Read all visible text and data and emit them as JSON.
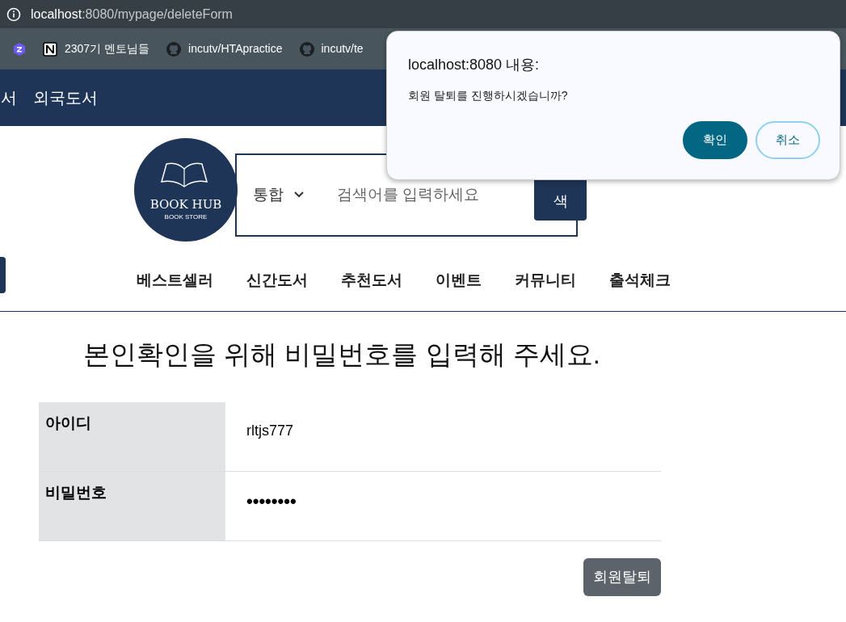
{
  "browser": {
    "url_host": "localhost",
    "url_path": ":8080/mypage/deleteForm",
    "bookmarks": [
      {
        "kind": "app"
      },
      {
        "kind": "notion",
        "label": "2307기 멘토님들"
      },
      {
        "kind": "github",
        "label": "incutv/HTApractice"
      },
      {
        "kind": "github",
        "label": "incutv/te"
      }
    ]
  },
  "top_nav": [
    "서",
    "외국도서"
  ],
  "search": {
    "category": "통합",
    "placeholder": "검색어를 입력하세요",
    "button": "색"
  },
  "logo": {
    "title": "BOOK HUB",
    "subtitle": "BOOK STORE"
  },
  "menu": [
    "베스트셀러",
    "신간도서",
    "추천도서",
    "이벤트",
    "커뮤니티",
    "출석체크"
  ],
  "heading": "본인확인을 위해 비밀번호를 입력해 주세요.",
  "form": [
    {
      "label": "아이디",
      "kind": "text",
      "value": "rltjs777"
    },
    {
      "label": "비밀번호",
      "kind": "password",
      "value": "••••••••"
    }
  ],
  "submit": "회원탈퇴",
  "dialog": {
    "title": "localhost:8080 내용:",
    "message": "회원 탈퇴를 진행하시겠습니까?",
    "buttons": [
      {
        "label": "확인",
        "kind": "primary"
      },
      {
        "label": "취소",
        "kind": "secondary"
      }
    ]
  }
}
